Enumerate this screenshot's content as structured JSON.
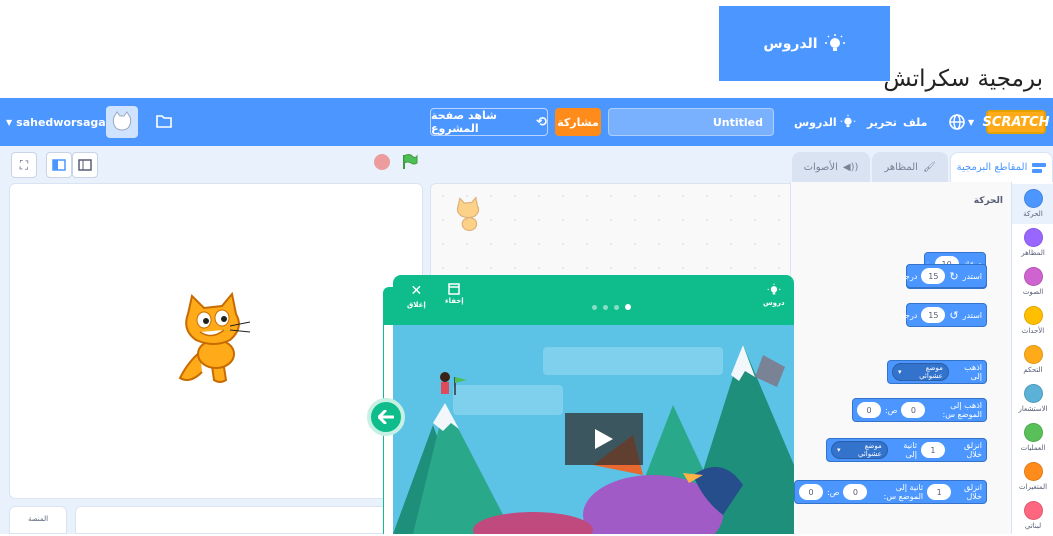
{
  "page": {
    "title": "برمجية سكراتش",
    "tutorials_badge": "الدروس"
  },
  "menu_bar": {
    "logo": "SCRATCH",
    "file": "ملف",
    "edit": "تحرير",
    "tutorials": "الدروس",
    "project_title": "Untitled",
    "share": "مشاركة",
    "see_project_page": "شاهد صفحة المشروع",
    "username": "sahedworsaga"
  },
  "tabs": {
    "code": "المقاطع البرمجية",
    "costumes": "المظاهر",
    "sounds": "الأصوات"
  },
  "categories": [
    {
      "label": "الحركة",
      "color": "#4c97ff"
    },
    {
      "label": "المظاهر",
      "color": "#9966ff"
    },
    {
      "label": "الصوت",
      "color": "#cf63cf"
    },
    {
      "label": "الأحداث",
      "color": "#ffbf00"
    },
    {
      "label": "التحكم",
      "color": "#ffab19"
    },
    {
      "label": "الاستشعار",
      "color": "#5cb1d6"
    },
    {
      "label": "العمليات",
      "color": "#59c059"
    },
    {
      "label": "المتغيرات",
      "color": "#ff8c1a"
    },
    {
      "label": "لبناتي",
      "color": "#ff6680"
    }
  ],
  "palette": {
    "heading": "الحركة",
    "move": {
      "text": "تحرّك",
      "value": "10",
      "unit": "خطوة"
    },
    "turn_right": {
      "text": "استدر",
      "value": "15",
      "unit": "درجة"
    },
    "turn_left": {
      "text": "استدر",
      "value": "15",
      "unit": "درجة"
    },
    "goto": {
      "text": "اذهب إلى",
      "dropdown": "موضع عشوائي"
    },
    "goto_xy": {
      "text": "اذهب إلى الموضع س:",
      "x": "0",
      "y_label": "ص:",
      "y": "0"
    },
    "glide": {
      "text": "انزلق خلال",
      "secs": "1",
      "to": "ثانية إلى",
      "dropdown": "موضع عشوائي"
    },
    "glide_xy": {
      "text": "انزلق خلال",
      "secs": "1",
      "to": "ثانية إلى الموضع س:",
      "x": "0",
      "y_label": "ص:",
      "y": "0"
    }
  },
  "tutorial": {
    "close": "إغلاق",
    "shrink": "إخفاء",
    "tutorials": "دروس"
  },
  "sprite_pane": {
    "stage_label": "المنصة"
  },
  "colors": {
    "menu": "#4c97ff",
    "share": "#ff8c1a",
    "tutorial": "#0fbd8c"
  }
}
